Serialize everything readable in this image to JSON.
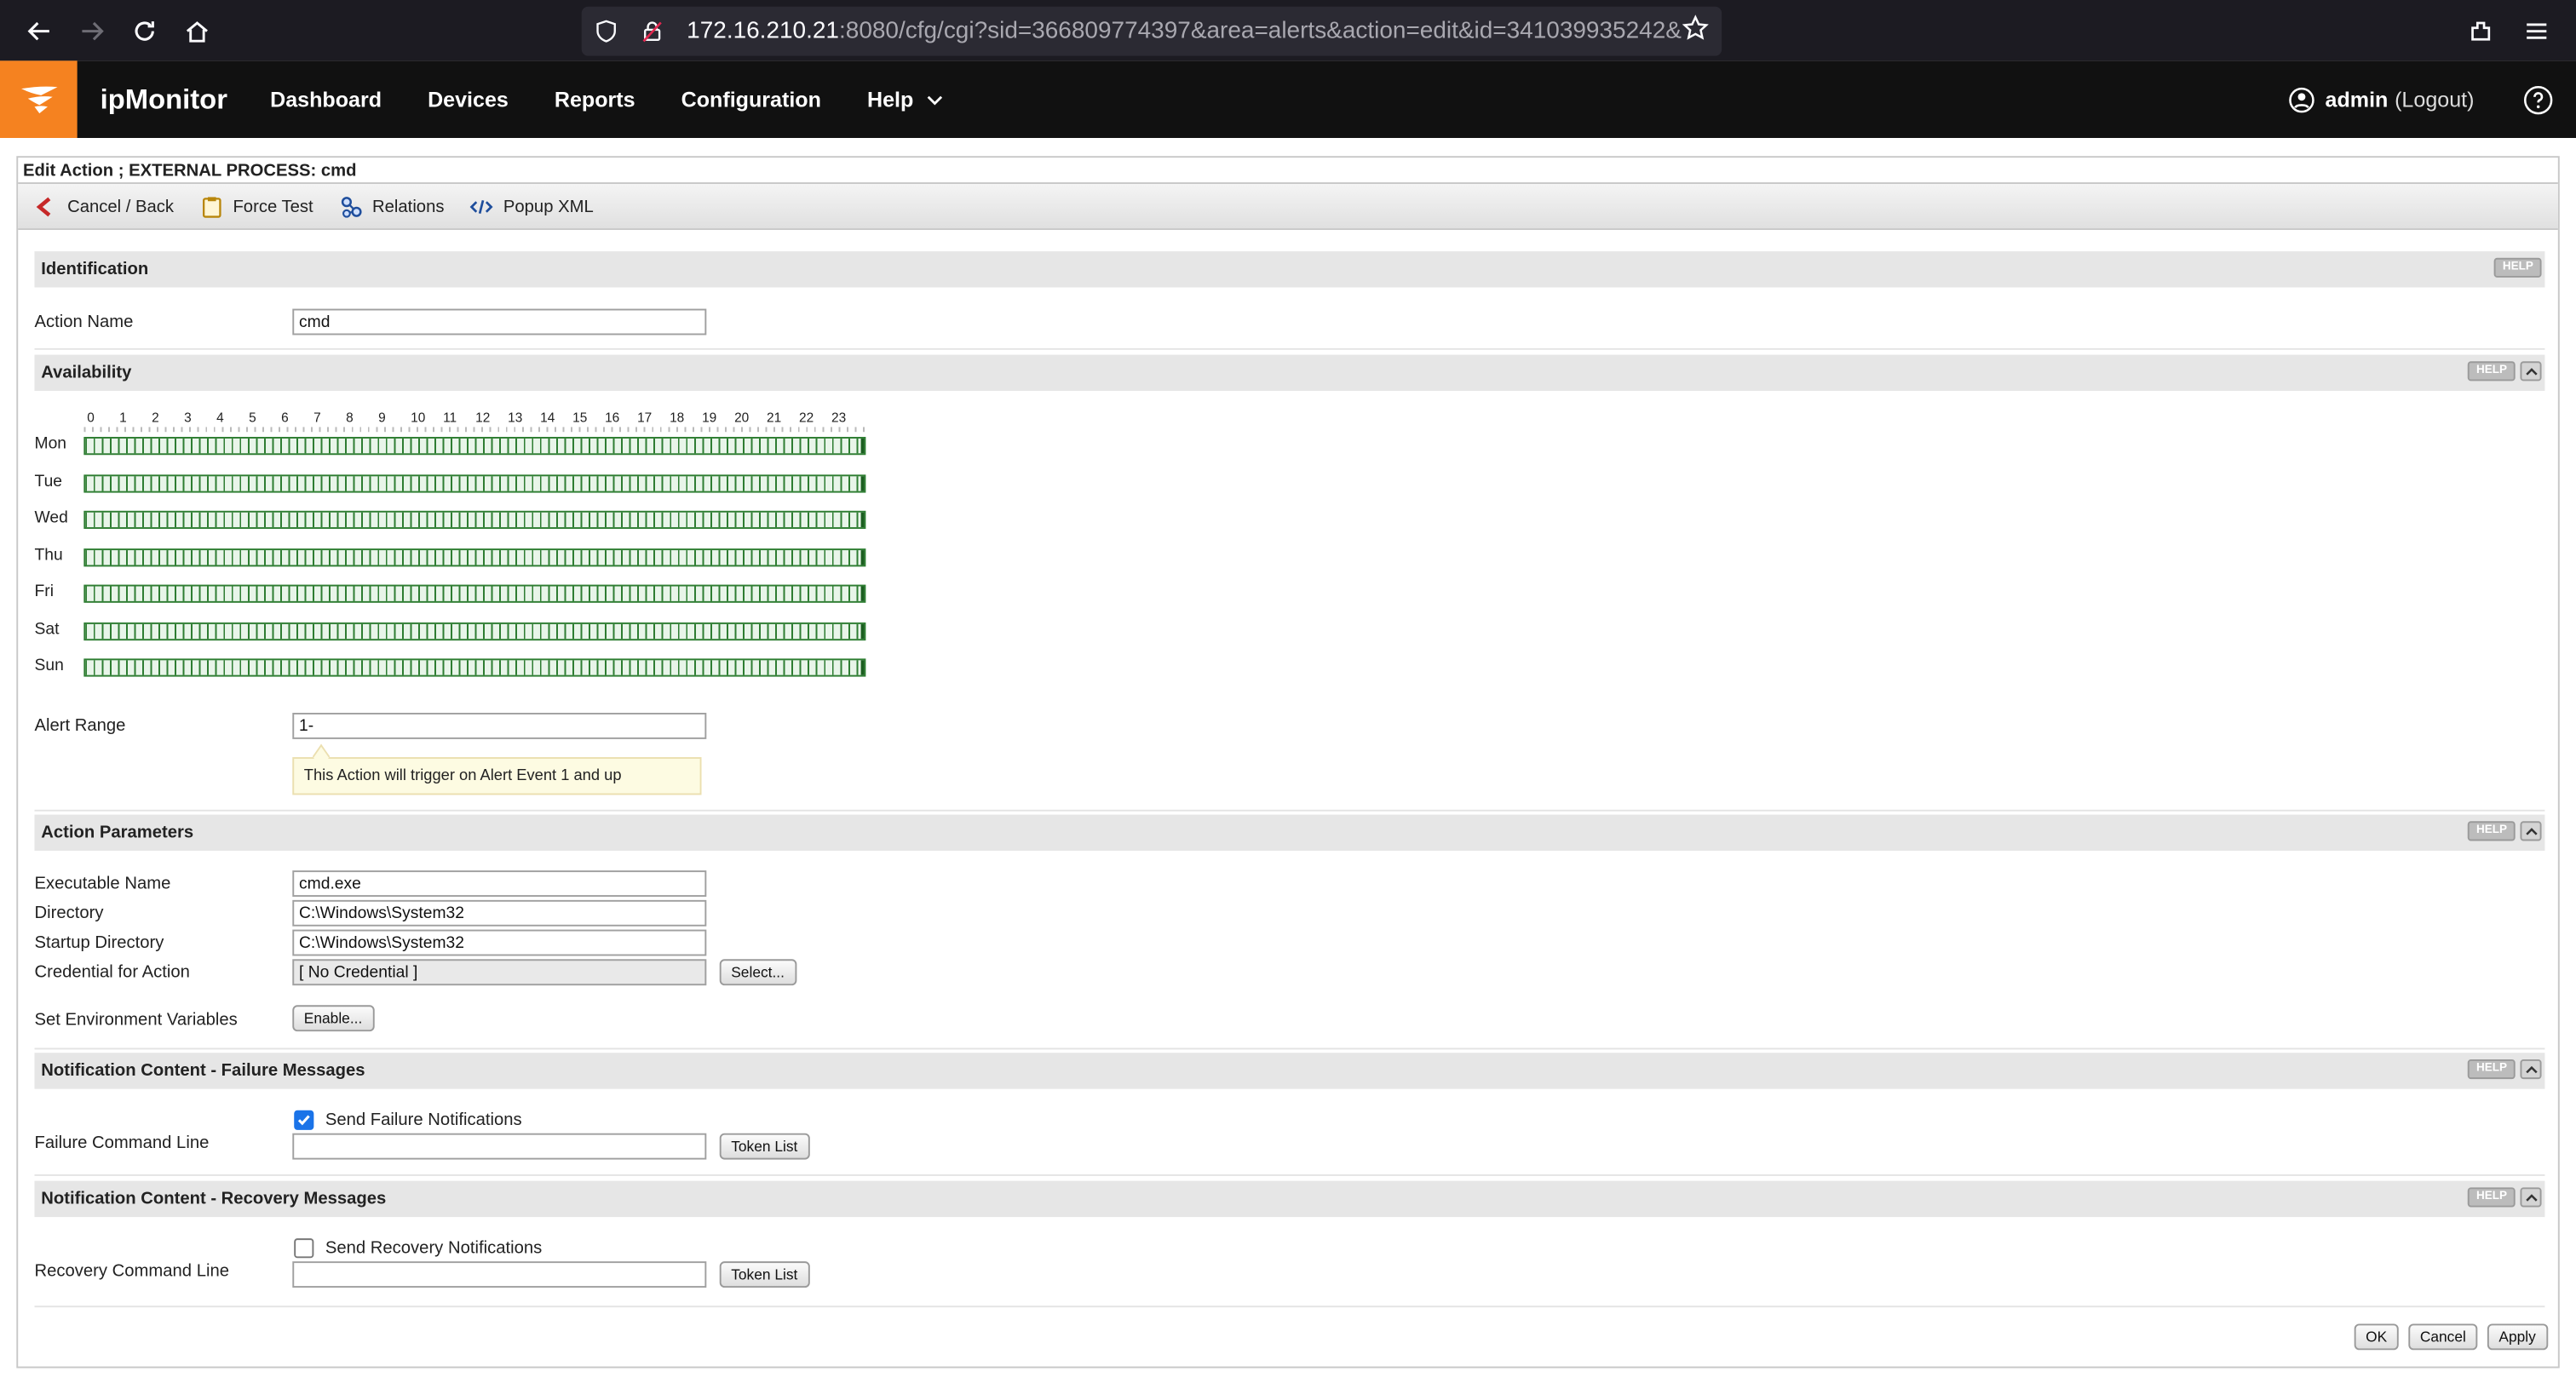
{
  "browser": {
    "url_host": "172.16.210.21",
    "url_rest": ":8080/cfg/cgi?sid=366809774397&area=alerts&action=edit&id=341039935242&"
  },
  "app": {
    "name": "ipMonitor",
    "nav": [
      "Dashboard",
      "Devices",
      "Reports",
      "Configuration",
      "Help"
    ],
    "user": "admin",
    "logout": "(Logout)"
  },
  "panel": {
    "title": "Edit Action ; EXTERNAL PROCESS: cmd",
    "toolbar": {
      "cancel": "Cancel / Back",
      "force_test": "Force Test",
      "relations": "Relations",
      "popup_xml": "Popup XML"
    }
  },
  "identification": {
    "title": "Identification",
    "help": "HELP",
    "action_name_label": "Action Name",
    "action_name_value": "cmd"
  },
  "availability": {
    "title": "Availability",
    "help": "HELP",
    "hours": [
      "0",
      "1",
      "2",
      "3",
      "4",
      "5",
      "6",
      "7",
      "8",
      "9",
      "10",
      "11",
      "12",
      "13",
      "14",
      "15",
      "16",
      "17",
      "18",
      "19",
      "20",
      "21",
      "22",
      "23"
    ],
    "days": [
      "Mon",
      "Tue",
      "Wed",
      "Thu",
      "Fri",
      "Sat",
      "Sun"
    ],
    "alert_range_label": "Alert Range",
    "alert_range_value": "1-",
    "alert_range_hint": "This Action will trigger on Alert Event 1 and up"
  },
  "params": {
    "title": "Action Parameters",
    "help": "HELP",
    "exe_label": "Executable Name",
    "exe_value": "cmd.exe",
    "dir_label": "Directory",
    "dir_value": "C:\\Windows\\System32",
    "startup_label": "Startup Directory",
    "startup_value": "C:\\Windows\\System32",
    "cred_label": "Credential for Action",
    "cred_value": "[ No Credential ]",
    "select_btn": "Select...",
    "env_label": "Set Environment Variables",
    "env_btn": "Enable..."
  },
  "failure": {
    "title": "Notification Content - Failure Messages",
    "help": "HELP",
    "send_label": "Send Failure Notifications",
    "send_checked": true,
    "cmd_label": "Failure Command Line",
    "cmd_value": "",
    "token_btn": "Token List"
  },
  "recovery": {
    "title": "Notification Content - Recovery Messages",
    "help": "HELP",
    "send_label": "Send Recovery Notifications",
    "send_checked": false,
    "cmd_label": "Recovery Command Line",
    "cmd_value": "",
    "token_btn": "Token List"
  },
  "footer": {
    "ok": "OK",
    "cancel": "Cancel",
    "apply": "Apply"
  },
  "colors": {
    "brand": "#f58220",
    "header": "#111111",
    "schedule_green": "#2e7d32"
  }
}
